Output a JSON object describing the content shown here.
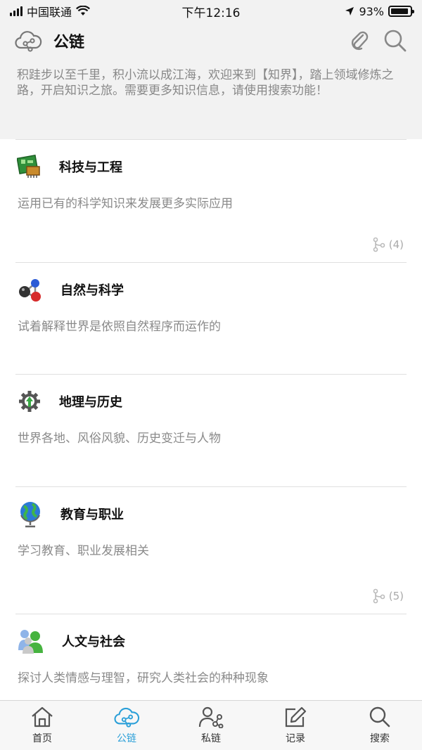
{
  "status": {
    "carrier": "中国联通",
    "time": "下午12:16",
    "battery": "93%",
    "battery_level": 0.93
  },
  "header": {
    "title": "公链",
    "icons": [
      "cloud-network-icon",
      "paperclip-icon",
      "search-icon"
    ]
  },
  "intro": "积跬步以至千里，积小流以成江海，欢迎来到【知界】，踏上领域修炼之路，开启知识之旅。需要更多知识信息，请使用搜索功能！",
  "categories": [
    {
      "name": "科技与工程",
      "desc": "运用已有的科学知识来发展更多实际应用",
      "count": "(4)",
      "icon": "circuit-board-icon"
    },
    {
      "name": "自然与科学",
      "desc": "试着解释世界是依照自然程序而运作的",
      "count": "",
      "icon": "molecule-icon"
    },
    {
      "name": "地理与历史",
      "desc": "世界各地、风俗风貌、历史变迁与人物",
      "count": "",
      "icon": "gear-tree-icon"
    },
    {
      "name": "教育与职业",
      "desc": "学习教育、职业发展相关",
      "count": "(5)",
      "icon": "globe-icon"
    },
    {
      "name": "人文与社会",
      "desc": "探讨人类情感与理智，研究人类社会的种种现象",
      "count": "",
      "icon": "people-icon"
    }
  ],
  "tabbar": [
    {
      "label": "首页",
      "icon": "home-icon",
      "active": false
    },
    {
      "label": "公链",
      "icon": "cloud-network-icon",
      "active": true
    },
    {
      "label": "私链",
      "icon": "user-share-icon",
      "active": false
    },
    {
      "label": "记录",
      "icon": "edit-icon",
      "active": false
    },
    {
      "label": "搜索",
      "icon": "search-icon",
      "active": false
    }
  ],
  "colors": {
    "accent": "#2a9fd8",
    "text_muted": "#8a8a8a"
  }
}
